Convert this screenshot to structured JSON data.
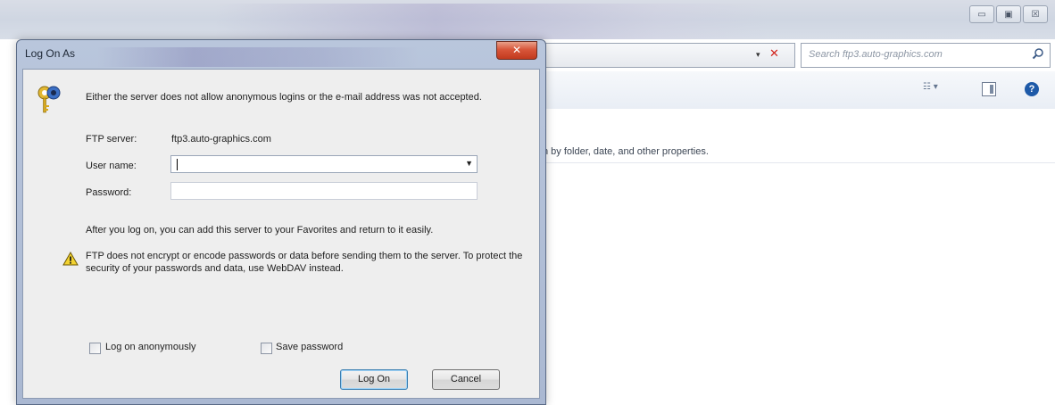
{
  "background_window": {
    "search_placeholder": "Search ftp3.auto-graphics.com",
    "info_text": "n by folder, date, and other properties.",
    "window_controls": {
      "minimize": "▭",
      "maximize": "▣",
      "close": "☒"
    }
  },
  "dialog": {
    "title": "Log On As",
    "close_glyph": "✕",
    "message": "Either the server does not allow anonymous logins or the e-mail address was not accepted.",
    "ftp_server_label": "FTP server:",
    "ftp_server_value": "ftp3.auto-graphics.com",
    "user_name_label": "User name:",
    "user_name_value": "",
    "password_label": "Password:",
    "password_value": "",
    "after_logon_text": "After you log on, you can add this server to your Favorites and return to it easily.",
    "warning_text": "FTP does not encrypt or encode passwords or data before sending them to the server.  To protect the security of your passwords and data, use WebDAV instead.",
    "log_on_anonymously_label": "Log on anonymously",
    "log_on_anonymously_checked": false,
    "save_password_label": "Save password",
    "save_password_checked": false,
    "log_on_button": "Log On",
    "cancel_button": "Cancel"
  },
  "icons": {
    "keys": "keys-icon",
    "warning": "warning-icon",
    "search": "search-icon",
    "help": "help-icon",
    "preview_pane": "preview-pane-icon",
    "view_options": "view-options-icon"
  },
  "colors": {
    "dialog_frame": "#aab8d2",
    "dialog_body": "#eeeeee",
    "close_button": "#c23a1e",
    "help_icon": "#1e5aa8",
    "address_clear": "#d2231c"
  }
}
